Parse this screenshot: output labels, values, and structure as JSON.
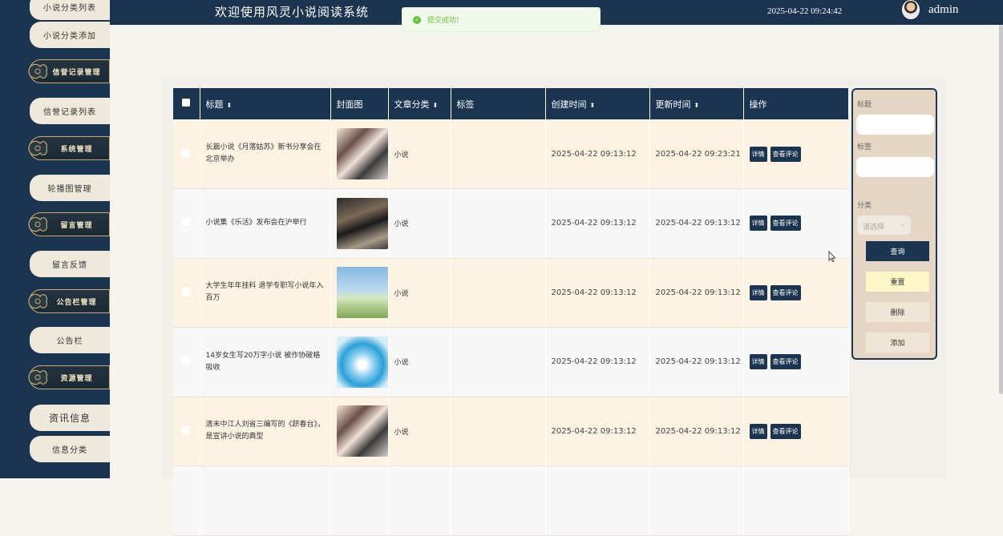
{
  "header": {
    "title": "欢迎使用风灵小说阅读系统",
    "datetime": "2025-04-22 09:24:42",
    "username": "admin"
  },
  "toast": {
    "message": "提交成功!"
  },
  "sidebar": {
    "items": [
      {
        "label": "小说分类列表",
        "type": "sub"
      },
      {
        "label": "小说分类添加",
        "type": "sub"
      },
      {
        "label": "信誉记录管理",
        "type": "group"
      },
      {
        "label": "信誉记录列表",
        "type": "sub"
      },
      {
        "label": "系统管理",
        "type": "group"
      },
      {
        "label": "轮播图管理",
        "type": "sub"
      },
      {
        "label": "留言管理",
        "type": "group"
      },
      {
        "label": "留言反馈",
        "type": "sub"
      },
      {
        "label": "公告栏管理",
        "type": "group"
      },
      {
        "label": "公告栏",
        "type": "sub"
      },
      {
        "label": "资源管理",
        "type": "group"
      },
      {
        "label": "资讯信息",
        "type": "sub"
      },
      {
        "label": "信息分类",
        "type": "sub"
      }
    ]
  },
  "table": {
    "columns": [
      "标题",
      "封面图",
      "文章分类",
      "标签",
      "创建时间",
      "更新时间",
      "操作"
    ],
    "rows": [
      {
        "title": "长篇小说《月落姑苏》新书分享会在北京举办",
        "category": "小说",
        "tag": "",
        "created": "2025-04-22 09:13:12",
        "updated": "2025-04-22 09:23:21",
        "cover": "girls"
      },
      {
        "title": "小说集《乐活》发布会在沪举行",
        "category": "小说",
        "tag": "",
        "created": "2025-04-22 09:13:12",
        "updated": "2025-04-22 09:13:12",
        "cover": "calligraphy"
      },
      {
        "title": "大学生年年挂科 退学专职写小说年入百万",
        "category": "小说",
        "tag": "",
        "created": "2025-04-22 09:13:12",
        "updated": "2025-04-22 09:13:12",
        "cover": "field"
      },
      {
        "title": "14岁女生写20万字小说 被作协破格吸收",
        "category": "小说",
        "tag": "",
        "created": "2025-04-22 09:13:12",
        "updated": "2025-04-22 09:13:12",
        "cover": "water"
      },
      {
        "title": "清末中江人刘省三编写的《跻春台》，是宣讲小说的典型",
        "category": "小说",
        "tag": "",
        "created": "2025-04-22 09:13:12",
        "updated": "2025-04-22 09:13:12",
        "cover": "girls"
      }
    ],
    "actions": {
      "detail": "详情",
      "comments": "查看评论"
    }
  },
  "search": {
    "title_label": "标题",
    "tag_label": "标签",
    "category_label": "分类",
    "category_placeholder": "请选择",
    "query_btn": "查询",
    "reset_btn": "重置",
    "delete_btn": "删除",
    "add_btn": "添加"
  },
  "colors": {
    "navy": "#1b3550",
    "cream": "#fdf3e3",
    "gold": "#c7ad75",
    "success": "#67c23a"
  }
}
